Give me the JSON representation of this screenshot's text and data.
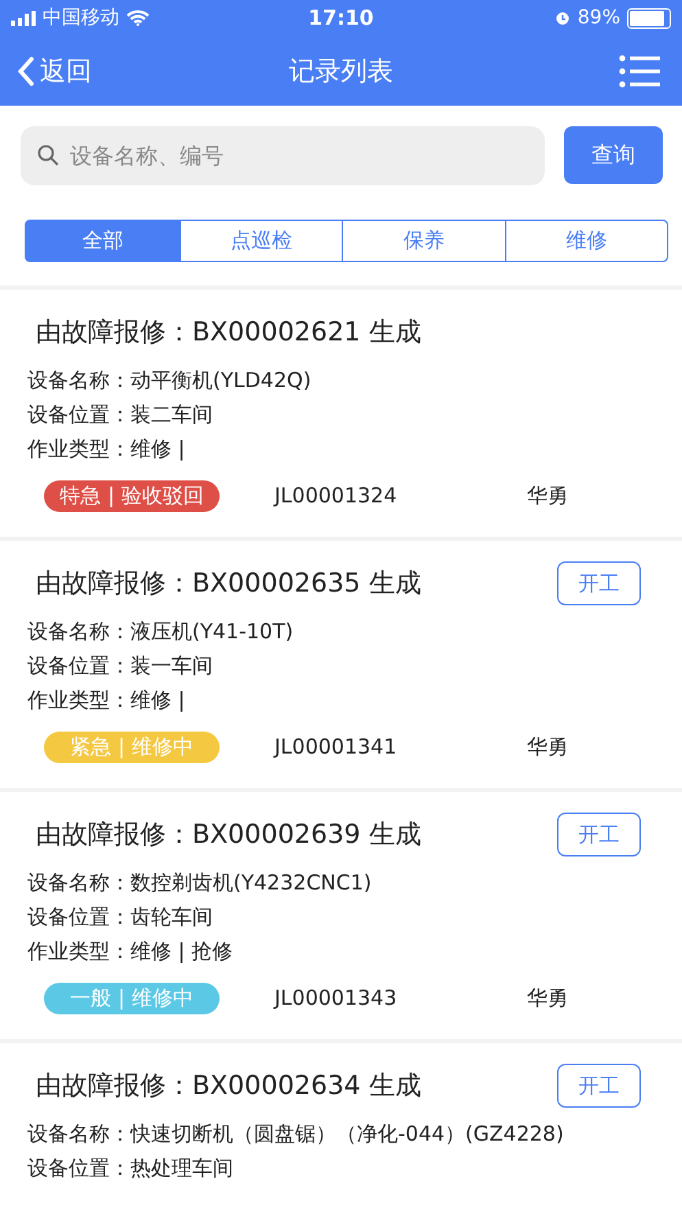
{
  "status_bar": {
    "carrier": "中国移动",
    "time": "17:10",
    "battery": "89%"
  },
  "nav": {
    "back": "返回",
    "title": "记录列表"
  },
  "search": {
    "placeholder": "设备名称、编号",
    "button": "查询"
  },
  "tabs": [
    {
      "label": "全部",
      "selected": true
    },
    {
      "label": "点巡检",
      "selected": false
    },
    {
      "label": "保养",
      "selected": false
    },
    {
      "label": "维修",
      "selected": false
    }
  ],
  "records": [
    {
      "title": "由故障报修：BX00002621 生成",
      "fields": [
        {
          "label": "设备名称：",
          "value": "动平衡机(YLD42Q)"
        },
        {
          "label": "设备位置：",
          "value": "装二车间"
        },
        {
          "label": "作业类型：",
          "value": "维修 |"
        }
      ],
      "badge": "特急 | 验收驳回",
      "color": "#de4f47",
      "code": "JL00001324",
      "person": "华勇"
    },
    {
      "title": "由故障报修：BX00002635 生成",
      "start_button": "开工",
      "fields": [
        {
          "label": "设备名称：",
          "value": "液压机(Y41-10T)"
        },
        {
          "label": "设备位置：",
          "value": "装一车间"
        },
        {
          "label": "作业类型：",
          "value": "维修 |"
        }
      ],
      "badge": "紧急 | 维修中",
      "color": "#f5c842",
      "code": "JL00001341",
      "person": "华勇"
    },
    {
      "title": "由故障报修：BX00002639 生成",
      "start_button": "开工",
      "fields": [
        {
          "label": "设备名称：",
          "value": "数控剃齿机(Y4232CNC1)"
        },
        {
          "label": "设备位置：",
          "value": "齿轮车间"
        },
        {
          "label": "作业类型：",
          "value": "维修 | 抢修"
        }
      ],
      "badge": "一般 | 维修中",
      "color": "#5bc9e5",
      "code": "JL00001343",
      "person": "华勇"
    },
    {
      "title": "由故障报修：BX00002634 生成",
      "start_button": "开工",
      "fields": [
        {
          "label": "设备名称：",
          "value": "快速切断机（圆盘锯）（净化-044）(GZ4228)"
        },
        {
          "label": "设备位置：",
          "value": "热处理车间"
        }
      ]
    }
  ]
}
